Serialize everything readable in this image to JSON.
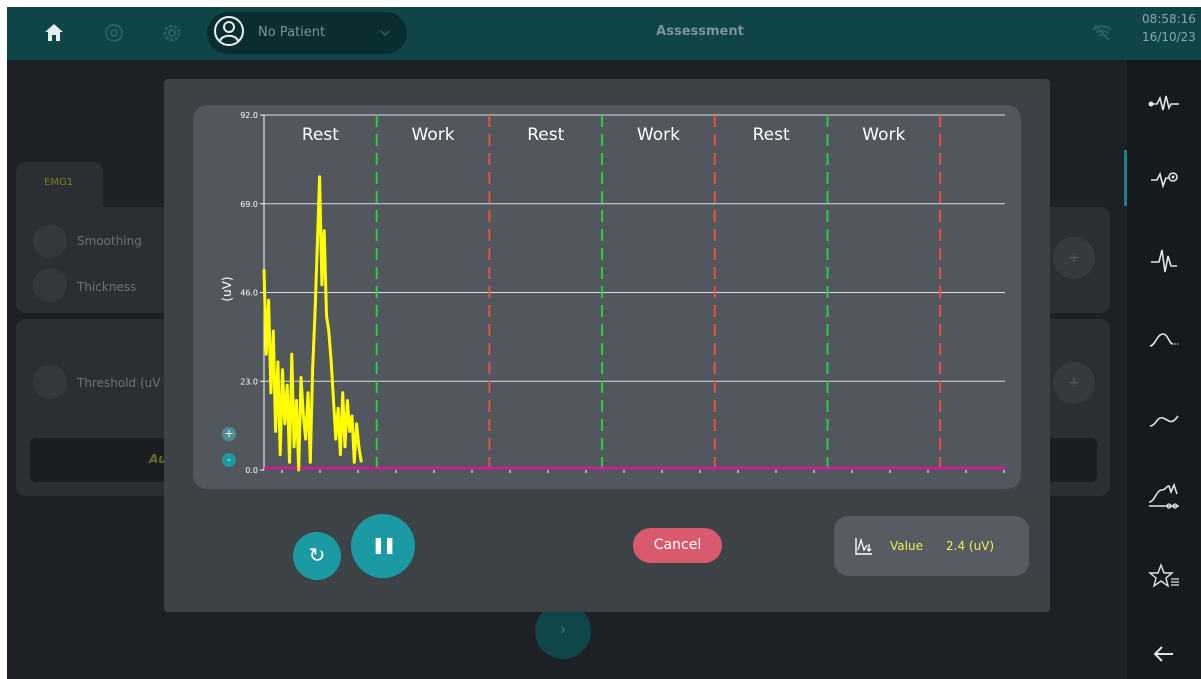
{
  "topbar": {
    "patient_name": "No Patient",
    "title": "Assessment",
    "time": "08:58:16",
    "date": "16/10/23",
    "icons": [
      "home-icon",
      "target-icon",
      "settings-icon",
      "avatar-icon",
      "chevron-down-icon",
      "wifi-off-icon"
    ]
  },
  "rail": {
    "icons": [
      "emg-signal-icon",
      "emg-view-icon",
      "emg-burst-icon",
      "envelope-icon",
      "wave-icon",
      "trend-icon",
      "favorites-icon",
      "back-arrow-icon"
    ],
    "selected_index": 1
  },
  "background": {
    "tab_label": "EMG1",
    "smoothing_label": "Smoothing",
    "thickness_label": "Thickness",
    "threshold_label": "Threshold (uV",
    "auto_label": "Au",
    "plus_label": "+",
    "next_label": "›"
  },
  "chart": {
    "y_unit_label": "(uV)",
    "zoom_in": "+",
    "zoom_out": "-",
    "accent_colors": {
      "signal": "#ffff00",
      "threshold": "#ff00aa",
      "rest_marker": "#e85040",
      "work_marker": "#2ecc40"
    }
  },
  "chart_data": {
    "type": "line",
    "ylabel": "(uV)",
    "ylim": [
      0,
      92
    ],
    "yticks": [
      "92.0",
      "69.0",
      "46.0",
      "23.0",
      "0.0"
    ],
    "ytick_values": [
      92,
      69,
      46,
      23,
      0
    ],
    "phases": [
      "Rest",
      "Work",
      "Rest",
      "Work",
      "Rest",
      "Work"
    ],
    "phase_marker_colors": [
      "#2ecc40",
      "#e85040",
      "#2ecc40",
      "#e85040",
      "#2ecc40",
      "#e85040"
    ],
    "threshold_value": 0.5,
    "signal_x": [
      0,
      0.3,
      0.6,
      0.9,
      1.2,
      1.5,
      1.8,
      2.1,
      2.4,
      2.7,
      3.0,
      3.3,
      3.6,
      3.9,
      4.2,
      4.5,
      4.8,
      5.1,
      5.4,
      5.7,
      6.0,
      6.3,
      6.6,
      6.9,
      7.2,
      7.5,
      7.8,
      8.1,
      8.4,
      8.7,
      9.0,
      9.3,
      9.6,
      9.9,
      10.2,
      10.5,
      10.8,
      11.1,
      11.4,
      11.7,
      12.0,
      12.3,
      12.6
    ],
    "signal_y": [
      52,
      30,
      44,
      20,
      36,
      10,
      28,
      4,
      26,
      12,
      22,
      2,
      30,
      6,
      18,
      0,
      24,
      14,
      8,
      20,
      2,
      26,
      40,
      58,
      76,
      48,
      62,
      40,
      36,
      28,
      18,
      8,
      16,
      4,
      20,
      6,
      18,
      10,
      14,
      2,
      12,
      6,
      2
    ],
    "x_min": 0,
    "x_max": 96,
    "signal_series_name": "",
    "phase_length": 14.6
  },
  "controls": {
    "refresh_label": "↻",
    "pause_label": "❚❚",
    "cancel_label": "Cancel",
    "value_label": "Value",
    "value_text": "2.4 (uV)"
  }
}
